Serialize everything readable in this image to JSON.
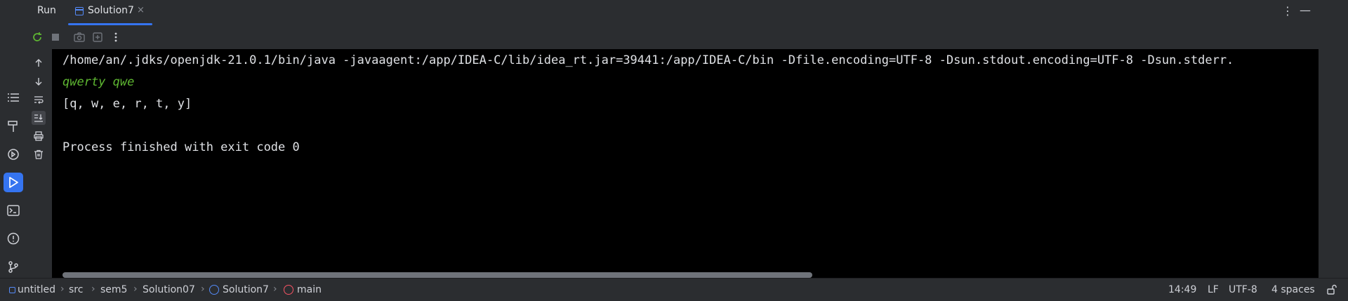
{
  "header": {
    "title": "Run",
    "tab": {
      "label": "Solution7",
      "close": "×"
    },
    "more": "⋮",
    "minimize": "—"
  },
  "console": {
    "lines": [
      {
        "text": "/home/an/.jdks/openjdk-21.0.1/bin/java -javaagent:/app/IDEA-C/lib/idea_rt.jar=39441:/app/IDEA-C/bin -Dfile.encoding=UTF-8 -Dsun.stdout.encoding=UTF-8 -Dsun.stderr.",
        "style": "normal"
      },
      {
        "text": "qwerty qwe",
        "style": "input"
      },
      {
        "text": "[q, w, e, r, t, y]",
        "style": "normal"
      },
      {
        "text": "",
        "style": "normal"
      },
      {
        "text": "Process finished with exit code 0",
        "style": "normal"
      }
    ]
  },
  "statusbar": {
    "breadcrumbs": [
      "untitled",
      "src",
      "sem5",
      "Solution07",
      "Solution7",
      "main"
    ],
    "position": "14:49",
    "line_ending": "LF",
    "encoding": "UTF-8",
    "indent": "4 spaces"
  },
  "colors": {
    "accent": "#3574f0",
    "console_bg": "#000000",
    "input_text": "#5fb832",
    "class_icon": "#548af7",
    "method_icon": "#f75464"
  }
}
